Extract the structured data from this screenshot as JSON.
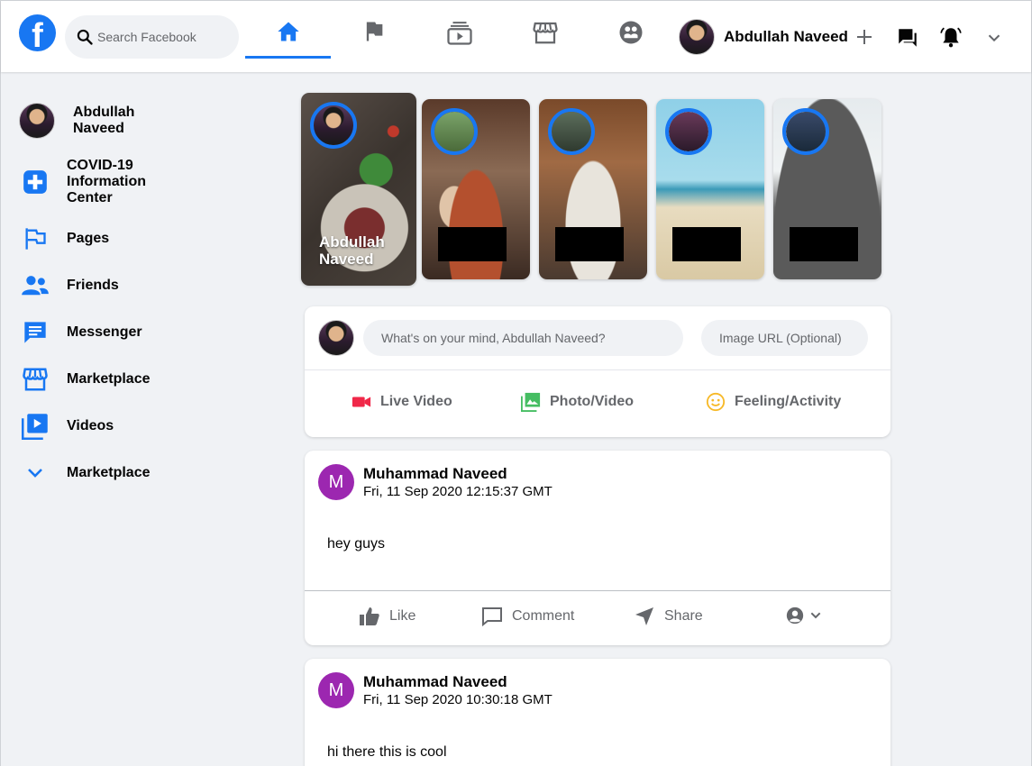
{
  "header": {
    "logo_letter": "f",
    "search_placeholder": "Search Facebook",
    "user_name": "Abdullah Naveed",
    "nav_tabs": [
      {
        "name": "home",
        "icon": "home-icon",
        "active": true
      },
      {
        "name": "pages",
        "icon": "flag-icon",
        "active": false
      },
      {
        "name": "watch",
        "icon": "watch-icon",
        "active": false
      },
      {
        "name": "marketplace",
        "icon": "store-icon",
        "active": false
      },
      {
        "name": "groups",
        "icon": "groups-icon",
        "active": false
      }
    ],
    "right_icons": [
      "plus-icon",
      "messenger-icon",
      "bell-icon",
      "chevron-down-icon"
    ]
  },
  "sidebar": {
    "profile_name_line1": "Abdullah",
    "profile_name_line2": "Naveed",
    "items": [
      {
        "label_lines": [
          "COVID-19",
          "Information",
          "Center"
        ],
        "icon": "covid-plus-icon"
      },
      {
        "label": "Pages",
        "icon": "flag-icon"
      },
      {
        "label": "Friends",
        "icon": "friends-icon"
      },
      {
        "label": "Messenger",
        "icon": "messenger-icon"
      },
      {
        "label": "Marketplace",
        "icon": "store-icon"
      },
      {
        "label": "Videos",
        "icon": "video-icon"
      },
      {
        "label": "Marketplace",
        "icon": "chevron-down-icon"
      }
    ]
  },
  "stories": {
    "own_label_line1": "Abdullah",
    "own_label_line2": "Naveed"
  },
  "composer": {
    "status_placeholder": "What's on your mind, Abdullah Naveed?",
    "image_placeholder": "Image URL (Optional)",
    "actions": [
      {
        "label": "Live Video",
        "icon": "live-video-icon",
        "color": "#f02849"
      },
      {
        "label": "Photo/Video",
        "icon": "photo-icon",
        "color": "#45bd62"
      },
      {
        "label": "Feeling/Activity",
        "icon": "smile-icon",
        "color": "#f7b928"
      }
    ]
  },
  "posts": [
    {
      "avatar_letter": "M",
      "author": "Muhammad Naveed",
      "timestamp": "Fri, 11 Sep 2020 12:15:37 GMT",
      "text": "hey guys",
      "actions": {
        "like": "Like",
        "comment": "Comment",
        "share": "Share"
      }
    },
    {
      "avatar_letter": "M",
      "author": "Muhammad Naveed",
      "timestamp": "Fri, 11 Sep 2020 10:30:18 GMT",
      "text": "hi there this is cool"
    }
  ],
  "colors": {
    "brand": "#1877f2",
    "background": "#f0f2f5",
    "post_avatar": "#9c27b0",
    "secondary_text": "#65676b"
  }
}
